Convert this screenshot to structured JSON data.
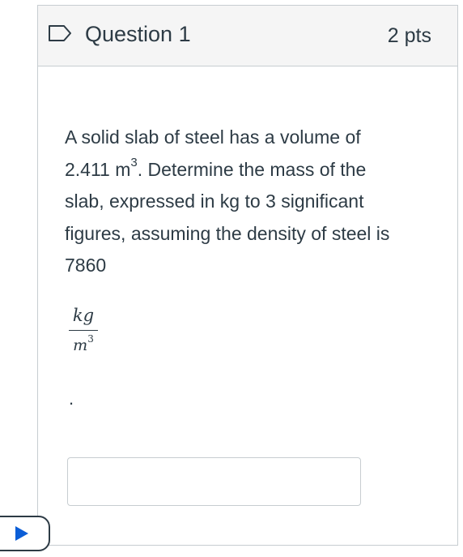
{
  "question": {
    "title": "Question 1",
    "points": "2 pts",
    "text": {
      "line1": "A solid slab of steel has a volume of",
      "volume_value": "2.411 m",
      "volume_exponent": "3",
      "line2_rest": ". Determine the mass of the",
      "line3": "slab, expressed in kg to 3 significant",
      "line4": "figures, assuming the density of steel is",
      "density_value": "7860"
    },
    "unit": {
      "numerator": "kg",
      "denominator_base": "m",
      "denominator_exponent": "3"
    },
    "trailing_punctuation": ".",
    "answer": {
      "value": "",
      "placeholder": ""
    }
  },
  "icons": {
    "flag": "flag-outline-icon",
    "play": "play-icon"
  },
  "colors": {
    "text": "#2d3b45",
    "header_bg": "#f5f5f5",
    "border": "#c7cdd1",
    "play_accent": "#0b5ed7"
  }
}
